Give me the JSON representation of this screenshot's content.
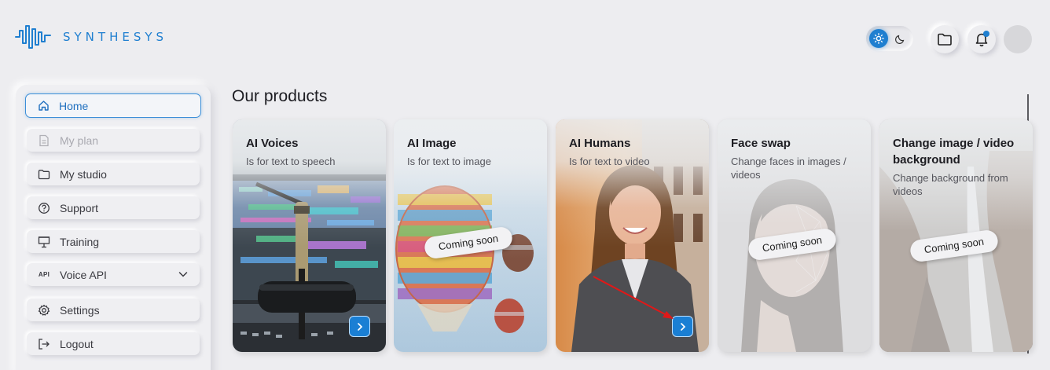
{
  "header": {
    "logo_text": "SYNTHESYS",
    "theme_toggle": {
      "light_icon": "sun-icon",
      "dark_icon": "moon-icon",
      "active": "light"
    },
    "folder_icon": "folder-icon",
    "bell_icon": "bell-icon",
    "has_notification": true
  },
  "sidebar": {
    "items": [
      {
        "label": "Home",
        "icon": "home-icon",
        "state": "active"
      },
      {
        "label": "My plan",
        "icon": "document-icon",
        "state": "disabled"
      },
      {
        "label": "My studio",
        "icon": "folder-icon",
        "state": "normal"
      },
      {
        "label": "Support",
        "icon": "help-circle-icon",
        "state": "normal"
      },
      {
        "label": "Training",
        "icon": "presentation-icon",
        "state": "normal"
      },
      {
        "label": "Voice API",
        "icon": "api-icon",
        "icon_text": "API",
        "state": "normal",
        "expandable": true
      },
      {
        "label": "Settings",
        "icon": "gear-icon",
        "state": "normal"
      },
      {
        "label": "Logout",
        "icon": "logout-icon",
        "state": "normal"
      }
    ]
  },
  "main": {
    "title": "Our products",
    "cards": [
      {
        "title": "AI Voices",
        "subtitle": "Is for text to speech",
        "coming_soon": false,
        "has_go_button": true
      },
      {
        "title": "AI Image",
        "subtitle": "Is for text to image",
        "coming_soon": true,
        "coming_soon_label": "Coming soon",
        "has_go_button": false
      },
      {
        "title": "AI Humans",
        "subtitle": "Is for text to video",
        "coming_soon": false,
        "has_go_button": true
      },
      {
        "title": "Face swap",
        "subtitle": "Change faces in images / videos",
        "coming_soon": true,
        "coming_soon_label": "Coming soon",
        "has_go_button": false
      },
      {
        "title": "Change image / video background",
        "subtitle": "Change background from videos",
        "coming_soon": true,
        "coming_soon_label": "Coming soon",
        "has_go_button": false
      }
    ]
  },
  "colors": {
    "accent": "#1f7fd0",
    "background": "#ededf0",
    "annotation_arrow": "#e01818"
  }
}
